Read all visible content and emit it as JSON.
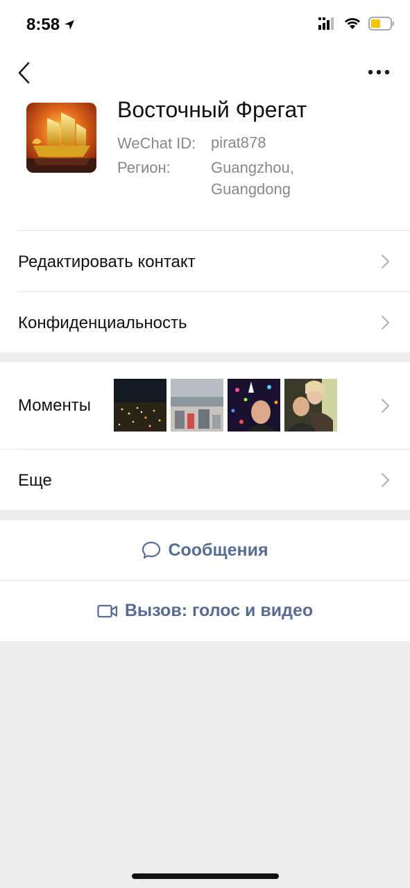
{
  "status": {
    "time": "8:58"
  },
  "profile": {
    "name": "Восточный Фрегат",
    "wechat_id_label": "WeChat ID:",
    "wechat_id": "pirat878",
    "region_label": "Регион:",
    "region_line1": "Guangzhou,",
    "region_line2": "Guangdong"
  },
  "menu": {
    "edit_contact": "Редактировать контакт",
    "privacy": "Конфиденциальность",
    "moments": "Моменты",
    "more": "Еще"
  },
  "actions": {
    "messages": "Сообщения",
    "call": "Вызов: голос и видео"
  },
  "colors": {
    "accent": "#576b95",
    "background": "#ededed"
  }
}
